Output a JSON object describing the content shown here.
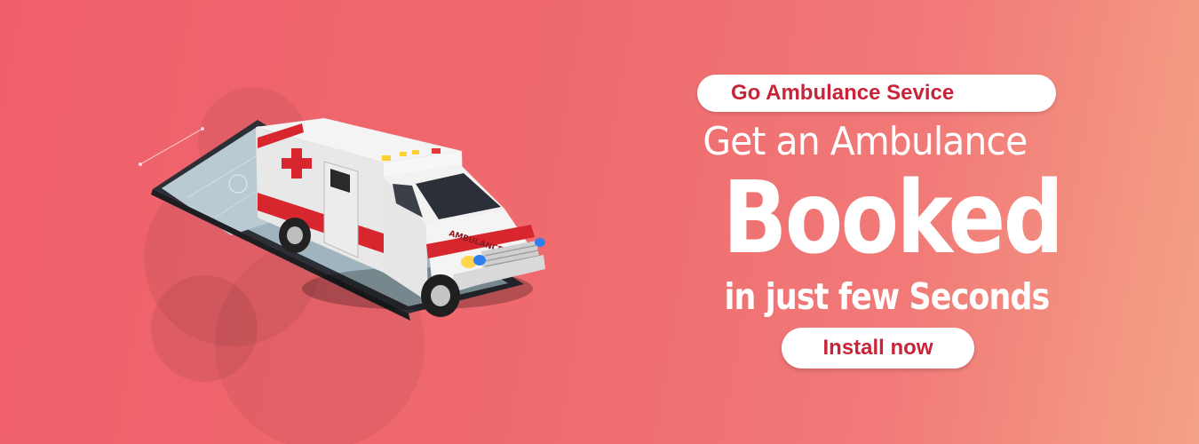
{
  "banner": {
    "badge_text": "Go Ambulance Sevice",
    "headline_line1": "Get an Ambulance",
    "headline_line2": "Booked",
    "headline_line3": "in just few Seconds",
    "cta_label": "Install now",
    "ambulance_side_text": "AMBULANCE"
  },
  "colors": {
    "background_start": "#ef5f6a",
    "background_end": "#f4a286",
    "accent_red": "#c8243a",
    "text_white": "#ffffff"
  },
  "icons": {
    "illustration": "ambulance-on-phone-icon",
    "cross": "red-cross-icon"
  }
}
